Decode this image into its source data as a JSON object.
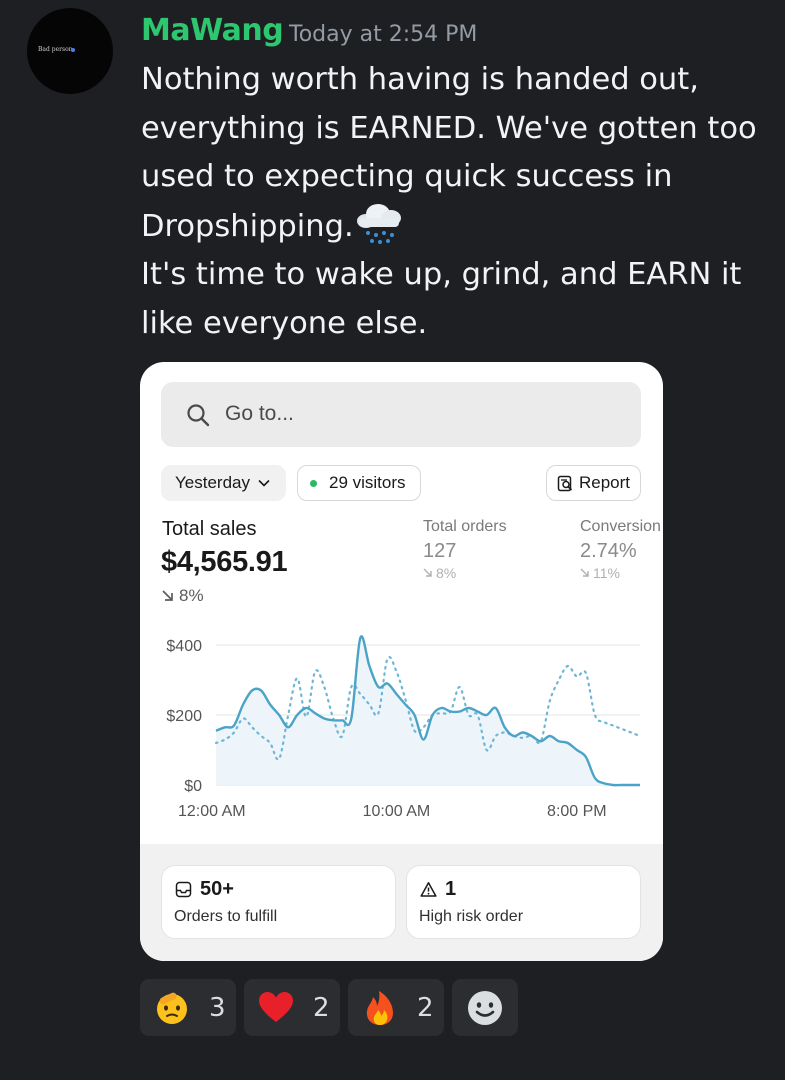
{
  "author": {
    "avatar_text": "Bad person",
    "username": "MaWang",
    "timestamp": "Today at 2:54 PM"
  },
  "message": {
    "line1": "Nothing worth having is handed out,",
    "line2": "everything is EARNED. We've gotten too",
    "line3": "used to expecting quick success  in",
    "line4": "Dropshipping.",
    "line4_emoji": "cloud-with-rain-emoji",
    "line5": "It's time to wake up, grind, and EARN it",
    "line6": "like everyone else."
  },
  "attachment": {
    "search": {
      "placeholder": "Go to..."
    },
    "period_selector": "Yesterday",
    "visitors": "29 visitors",
    "report_button": "Report",
    "total_sales": {
      "label": "Total sales",
      "value": "$4,565.91",
      "change": "8%"
    },
    "total_orders": {
      "label": "Total orders",
      "value": "127",
      "change": "8%"
    },
    "conversion": {
      "label": "Conversion",
      "value": "2.74%",
      "change": "11%"
    },
    "footer": {
      "orders_to_fulfill": {
        "value": "50+",
        "label": "Orders to fulfill"
      },
      "high_risk": {
        "value": "1",
        "label": "High risk order"
      }
    },
    "chart_data": {
      "type": "line",
      "ylim": [
        0,
        400
      ],
      "yticks": [
        "$400",
        "$200",
        "$0"
      ],
      "xticks": [
        "12:00 AM",
        "10:00 AM",
        "8:00 PM"
      ],
      "x_hours": [
        0,
        0.5,
        1,
        1.5,
        2,
        2.5,
        3,
        3.5,
        4,
        4.5,
        5,
        5.5,
        6,
        6.5,
        7,
        7.5,
        8,
        8.5,
        9,
        9.5,
        10,
        10.5,
        11,
        11.5,
        12,
        12.5,
        13,
        13.5,
        14,
        14.5,
        15,
        15.5,
        16,
        16.5,
        17,
        17.5,
        18,
        18.5,
        19,
        19.5,
        20,
        20.5,
        21,
        21.5,
        22,
        22.5,
        23,
        23.5
      ],
      "series": [
        {
          "style": "solid",
          "color": "#4ba3c7",
          "values": [
            155,
            165,
            170,
            230,
            270,
            270,
            230,
            200,
            165,
            200,
            220,
            205,
            190,
            185,
            185,
            190,
            420,
            340,
            280,
            290,
            260,
            230,
            200,
            130,
            200,
            220,
            210,
            210,
            220,
            210,
            200,
            220,
            165,
            140,
            150,
            140,
            125,
            140,
            125,
            120,
            100,
            80,
            20,
            5,
            0,
            0,
            0,
            0
          ]
        },
        {
          "style": "dotted",
          "color": "#6fb6d6",
          "values": [
            120,
            130,
            150,
            190,
            165,
            140,
            120,
            75,
            200,
            305,
            195,
            325,
            280,
            190,
            140,
            280,
            260,
            230,
            205,
            360,
            325,
            245,
            155,
            165,
            200,
            205,
            210,
            280,
            200,
            200,
            100,
            140,
            150,
            140,
            135,
            140,
            125,
            240,
            300,
            340,
            310,
            320,
            200,
            180,
            170,
            160,
            150,
            140
          ]
        }
      ]
    }
  },
  "reactions": [
    {
      "emoji": "saluting-face-emoji",
      "count": "3"
    },
    {
      "emoji": "red-heart-emoji",
      "count": "2"
    },
    {
      "emoji": "fire-emoji",
      "count": "2"
    },
    {
      "emoji": "add-reaction-icon"
    }
  ]
}
